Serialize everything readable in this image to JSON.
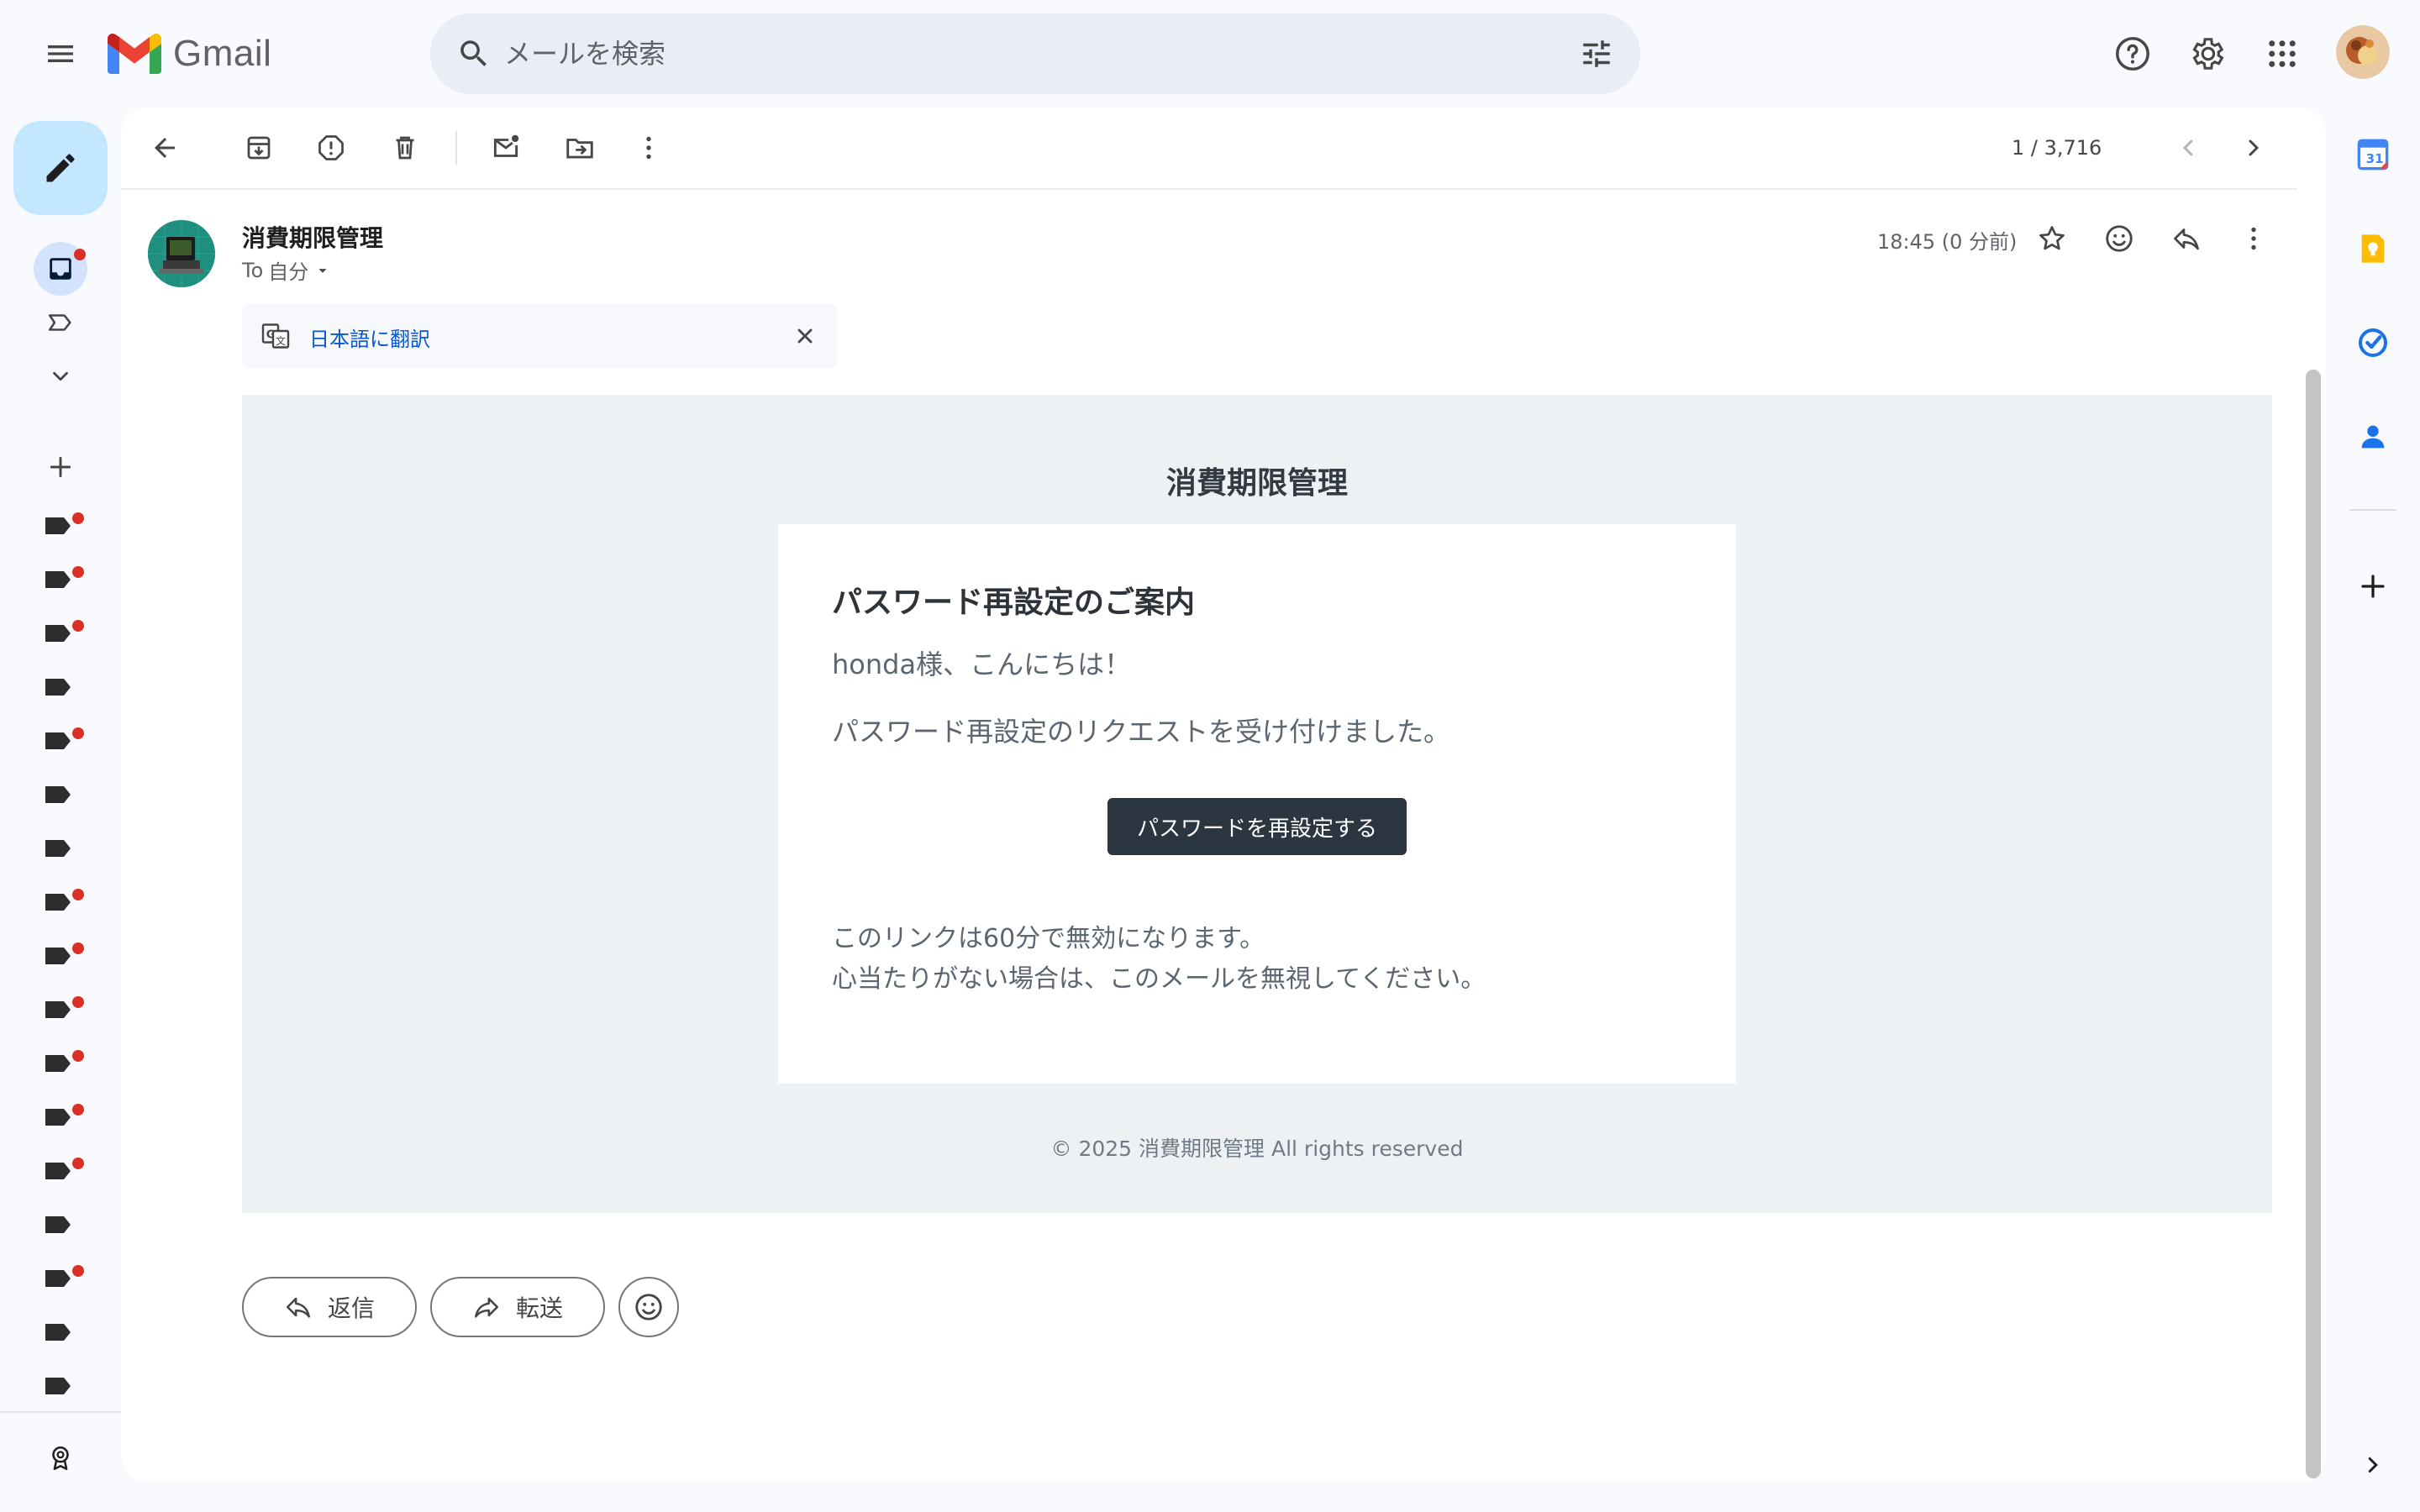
{
  "header": {
    "app_name": "Gmail",
    "search_placeholder": "メールを検索"
  },
  "toolbar": {
    "pager": "1 / 3,716"
  },
  "message": {
    "sender": "消費期限管理",
    "recipient_prefix": "To",
    "recipient": "自分",
    "time": "18:45 (0 分前)",
    "translate_label": "日本語に翻訳"
  },
  "email": {
    "brand": "消費期限管理",
    "title": "パスワード再設定のご案内",
    "greeting": "honda様、こんにちは！",
    "line1": "パスワード再設定のリクエストを受け付けました。",
    "button": "パスワードを再設定する",
    "note1": "このリンクは60分で無効になります。",
    "note2": "心当たりがない場合は、このメールを無視してください。",
    "footer": "©  2025  消費期限管理  All rights reserved"
  },
  "actions": {
    "reply": "返信",
    "forward": "転送"
  },
  "colors": {
    "accent": "#0b57d0",
    "compose_bg": "#c2e7ff",
    "unread_dot": "#d93025",
    "email_button": "#2b3641"
  }
}
